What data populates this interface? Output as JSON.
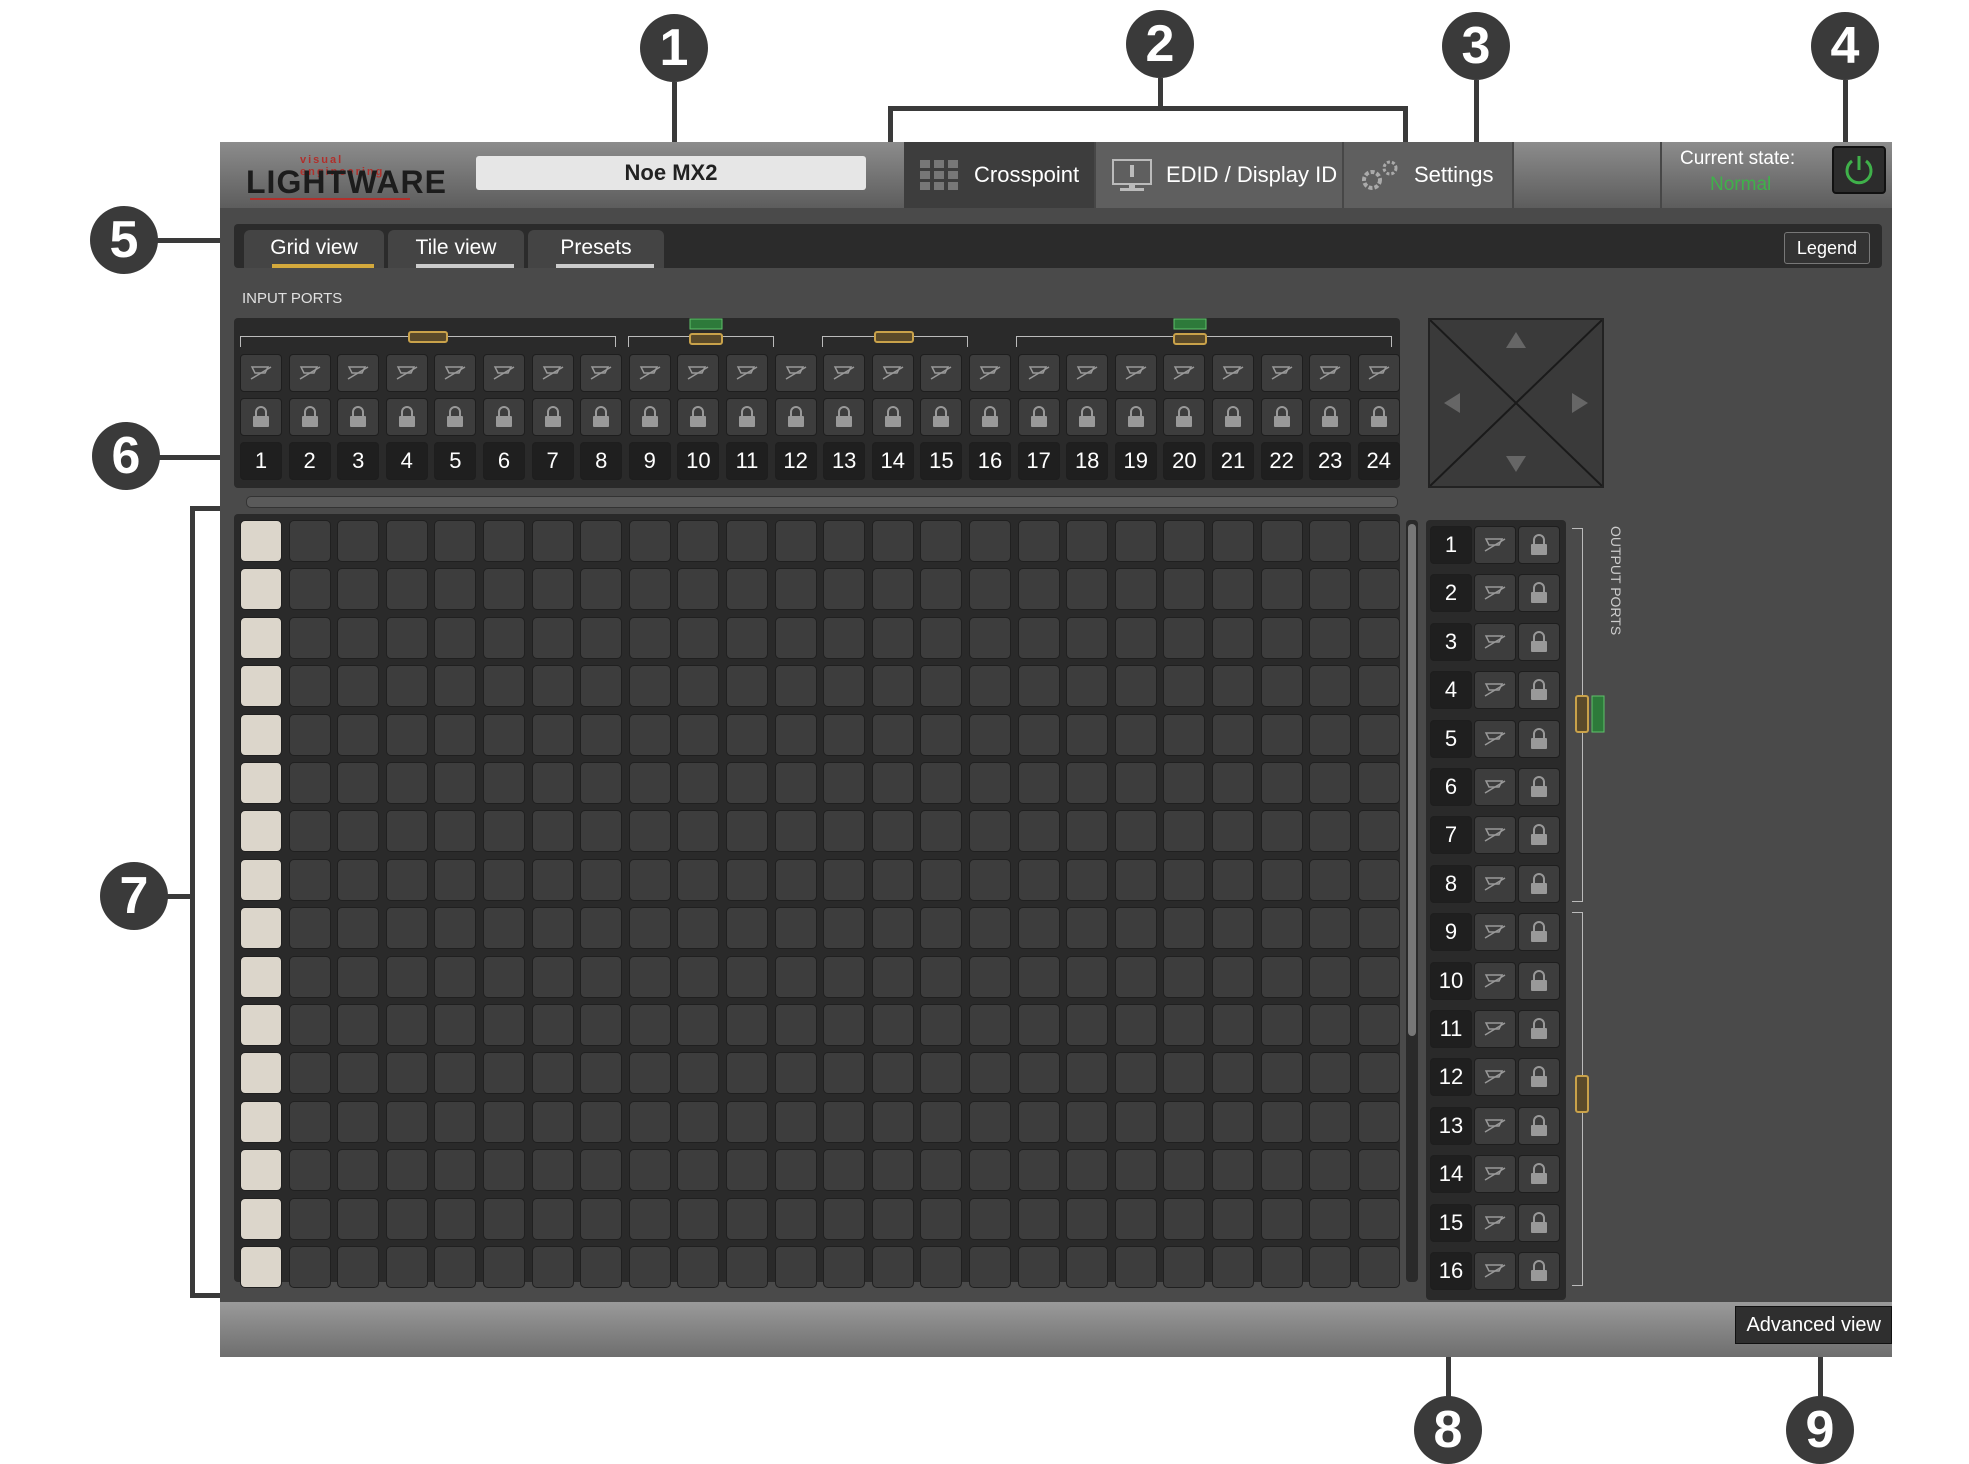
{
  "callouts": [
    "1",
    "2",
    "3",
    "4",
    "5",
    "6",
    "7",
    "8",
    "9"
  ],
  "header": {
    "logo_small": "visual engineering",
    "logo_big": "LIGHTWARE",
    "device_name": "Noe MX2",
    "nav": [
      {
        "label": "Crosspoint",
        "icon": "grid-icon"
      },
      {
        "label": "EDID / Display ID",
        "icon": "monitor-icon"
      },
      {
        "label": "Settings",
        "icon": "gears-icon"
      }
    ],
    "state_label": "Current state:",
    "state_value": "Normal",
    "power_icon": "power-icon"
  },
  "tabs": {
    "items": [
      "Grid view",
      "Tile view",
      "Presets"
    ],
    "active": "Grid view",
    "legend": "Legend"
  },
  "input_ports": {
    "title": "INPUT PORTS",
    "numbers": [
      "1",
      "2",
      "3",
      "4",
      "5",
      "6",
      "7",
      "8",
      "9",
      "10",
      "11",
      "12",
      "13",
      "14",
      "15",
      "16",
      "17",
      "18",
      "19",
      "20",
      "21",
      "22",
      "23",
      "24"
    ]
  },
  "output_ports": {
    "title": "OUTPUT PORTS",
    "numbers": [
      "1",
      "2",
      "3",
      "4",
      "5",
      "6",
      "7",
      "8",
      "9",
      "10",
      "11",
      "12",
      "13",
      "14",
      "15",
      "16"
    ]
  },
  "footer": {
    "advanced_view": "Advanced view"
  },
  "colors": {
    "accent": "#d4a93c",
    "state_normal": "#3fb14a",
    "callout": "#3a3a3a",
    "panel": "#2a2a2a",
    "cell": "#3d3d3d",
    "active_cell": "#dcd6cb"
  }
}
